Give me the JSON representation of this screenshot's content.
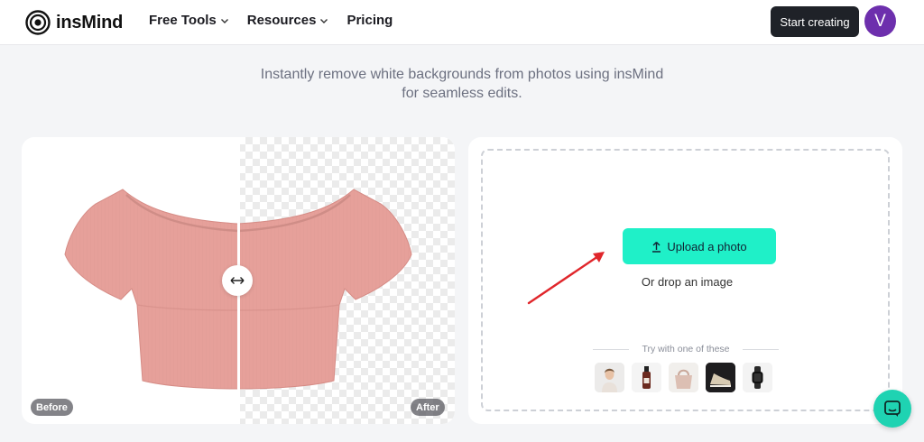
{
  "header": {
    "brand": "insMind",
    "nav": [
      {
        "label": "Free Tools",
        "dropdown": true
      },
      {
        "label": "Resources",
        "dropdown": true
      },
      {
        "label": "Pricing",
        "dropdown": false
      }
    ],
    "start_label": "Start creating",
    "avatar_initial": "V"
  },
  "hero": {
    "subtitle_line1": "Instantly remove white backgrounds from photos using insMind",
    "subtitle_line2": "for seamless edits."
  },
  "compare": {
    "before_label": "Before",
    "after_label": "After",
    "handle_icon": "horizontal-arrows-icon"
  },
  "upload": {
    "button_label": "Upload a photo",
    "button_icon": "upload-icon",
    "drop_text": "Or drop an image",
    "try_text": "Try with one of these",
    "samples": [
      "woman-portrait",
      "serum-bottle",
      "handbag",
      "sneaker",
      "smartwatch"
    ]
  },
  "colors": {
    "accent": "#1ff0c8",
    "primary_dark": "#1f2228",
    "avatar": "#6d2fad",
    "chat": "#1fd3b2",
    "annotation_arrow": "#e0262b"
  }
}
